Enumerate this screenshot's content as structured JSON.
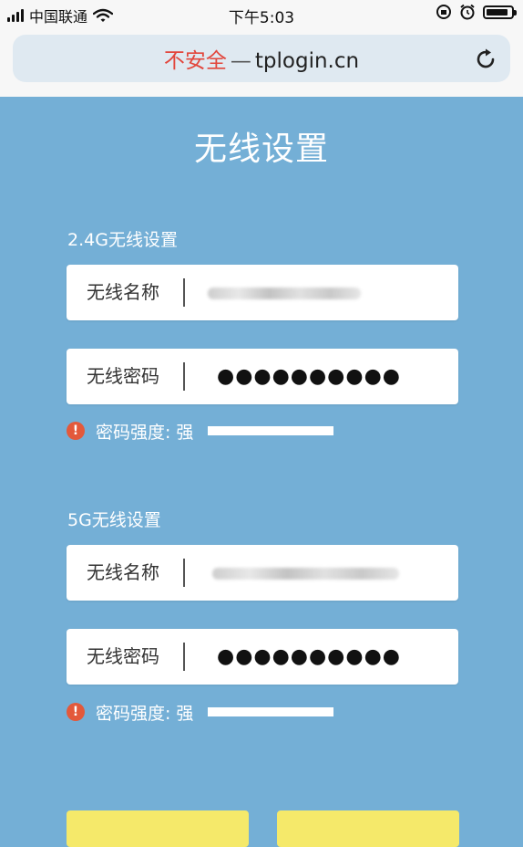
{
  "status_bar": {
    "carrier": "中国联通",
    "time": "下午5:03",
    "icons": [
      "signal-bars-icon",
      "wifi-icon",
      "orientation-lock-icon",
      "alarm-icon",
      "battery-icon"
    ]
  },
  "browser": {
    "insecure_label": "不安全",
    "separator": "—",
    "domain": "tplogin.cn",
    "reload_icon": "reload-icon"
  },
  "page": {
    "title": "无线设置",
    "background_color": "#74afd6",
    "sections": [
      {
        "heading": "2.4G无线设置",
        "name_label": "无线名称",
        "password_label": "无线密码",
        "password_value": "●●●●●●●●●●",
        "strength_label": "密码强度:",
        "strength_value": "强"
      },
      {
        "heading": "5G无线设置",
        "name_label": "无线名称",
        "password_label": "无线密码",
        "password_value": "●●●●●●●●●●",
        "strength_label": "密码强度:",
        "strength_value": "强"
      }
    ],
    "warning_icon": "warning-icon",
    "warning_color": "#e3593b",
    "button_color": "#f5e96a"
  }
}
